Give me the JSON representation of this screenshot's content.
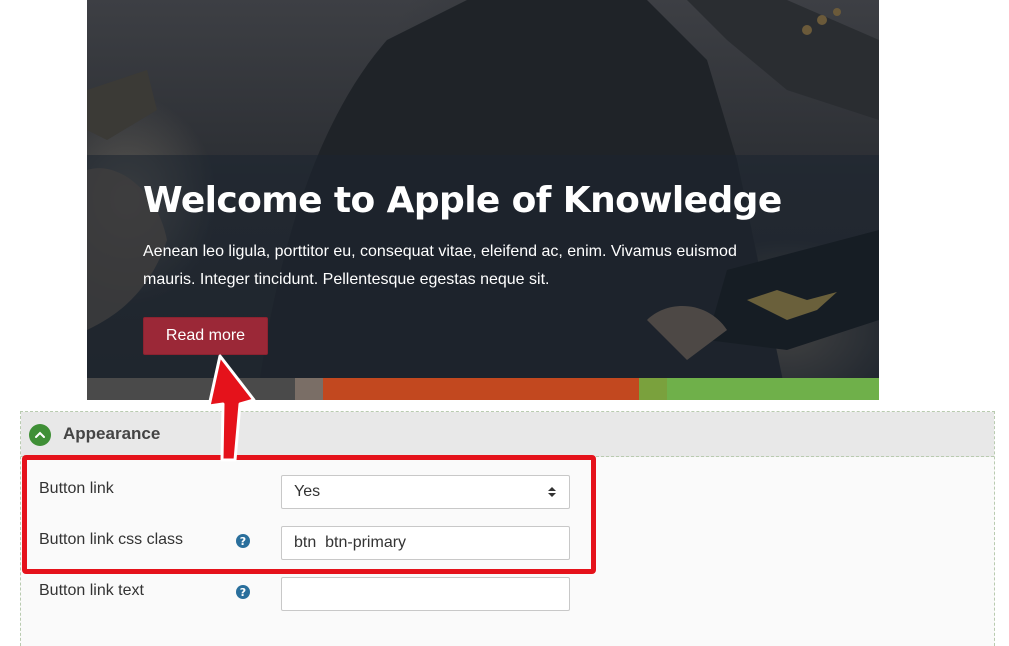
{
  "hero": {
    "title": "Welcome to Apple of Knowledge",
    "text": "Aenean leo ligula, porttitor eu, consequat vitae, eleifend ac, enim. Vivamus euismod mauris. Integer tincidunt. Pellentesque egestas neque sit.",
    "button_label": "Read more"
  },
  "appearance": {
    "title": "Appearance",
    "icon": "chevron-up-icon",
    "fields": [
      {
        "label": "Button link",
        "value": "Yes",
        "type": "select",
        "help": false
      },
      {
        "label": "Button link css class",
        "value": "btn  btn-primary",
        "type": "text",
        "help": true
      },
      {
        "label": "Button link text",
        "value": "",
        "type": "text",
        "help": true
      }
    ],
    "help_glyph": "?"
  },
  "annotations": {
    "highlight_color": "#e5121b",
    "arrow_color": "#e5121b"
  },
  "colors": {
    "button": "#9b2837",
    "accent_green": "#3f8f36",
    "help_blue": "#2a6f9c"
  }
}
